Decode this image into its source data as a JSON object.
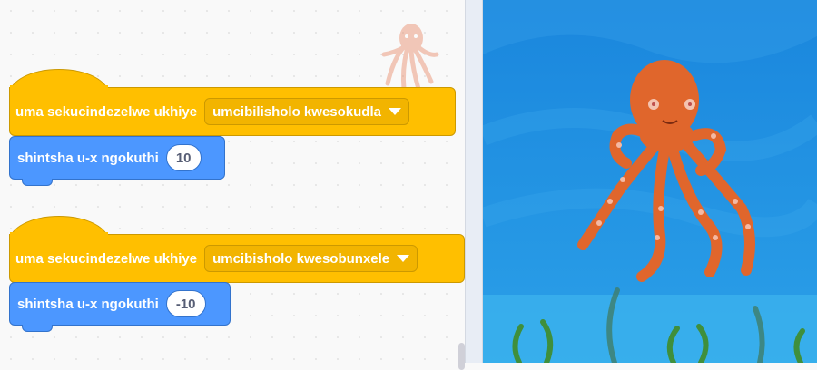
{
  "scripts": [
    {
      "hat_text": "uma sekucindezelwe ukhiye",
      "key_option": "umcibilisholo kwesokudla",
      "motion_text": "shintsha u-x ngokuthi",
      "value": "10"
    },
    {
      "hat_text": "uma sekucindezelwe ukhiye",
      "key_option": "umcibisholo kwesobunxele",
      "motion_text": "shintsha u-x ngokuthi",
      "value": "-10"
    }
  ],
  "colors": {
    "events": "#ffbf00",
    "motion": "#4c97ff",
    "stage_water": "#1f8fdf",
    "octopus": "#e0662c"
  },
  "icons": {
    "sprite_ghost": "octopus-sprite-icon",
    "dropdown_arrow": "triangle-down-icon"
  }
}
